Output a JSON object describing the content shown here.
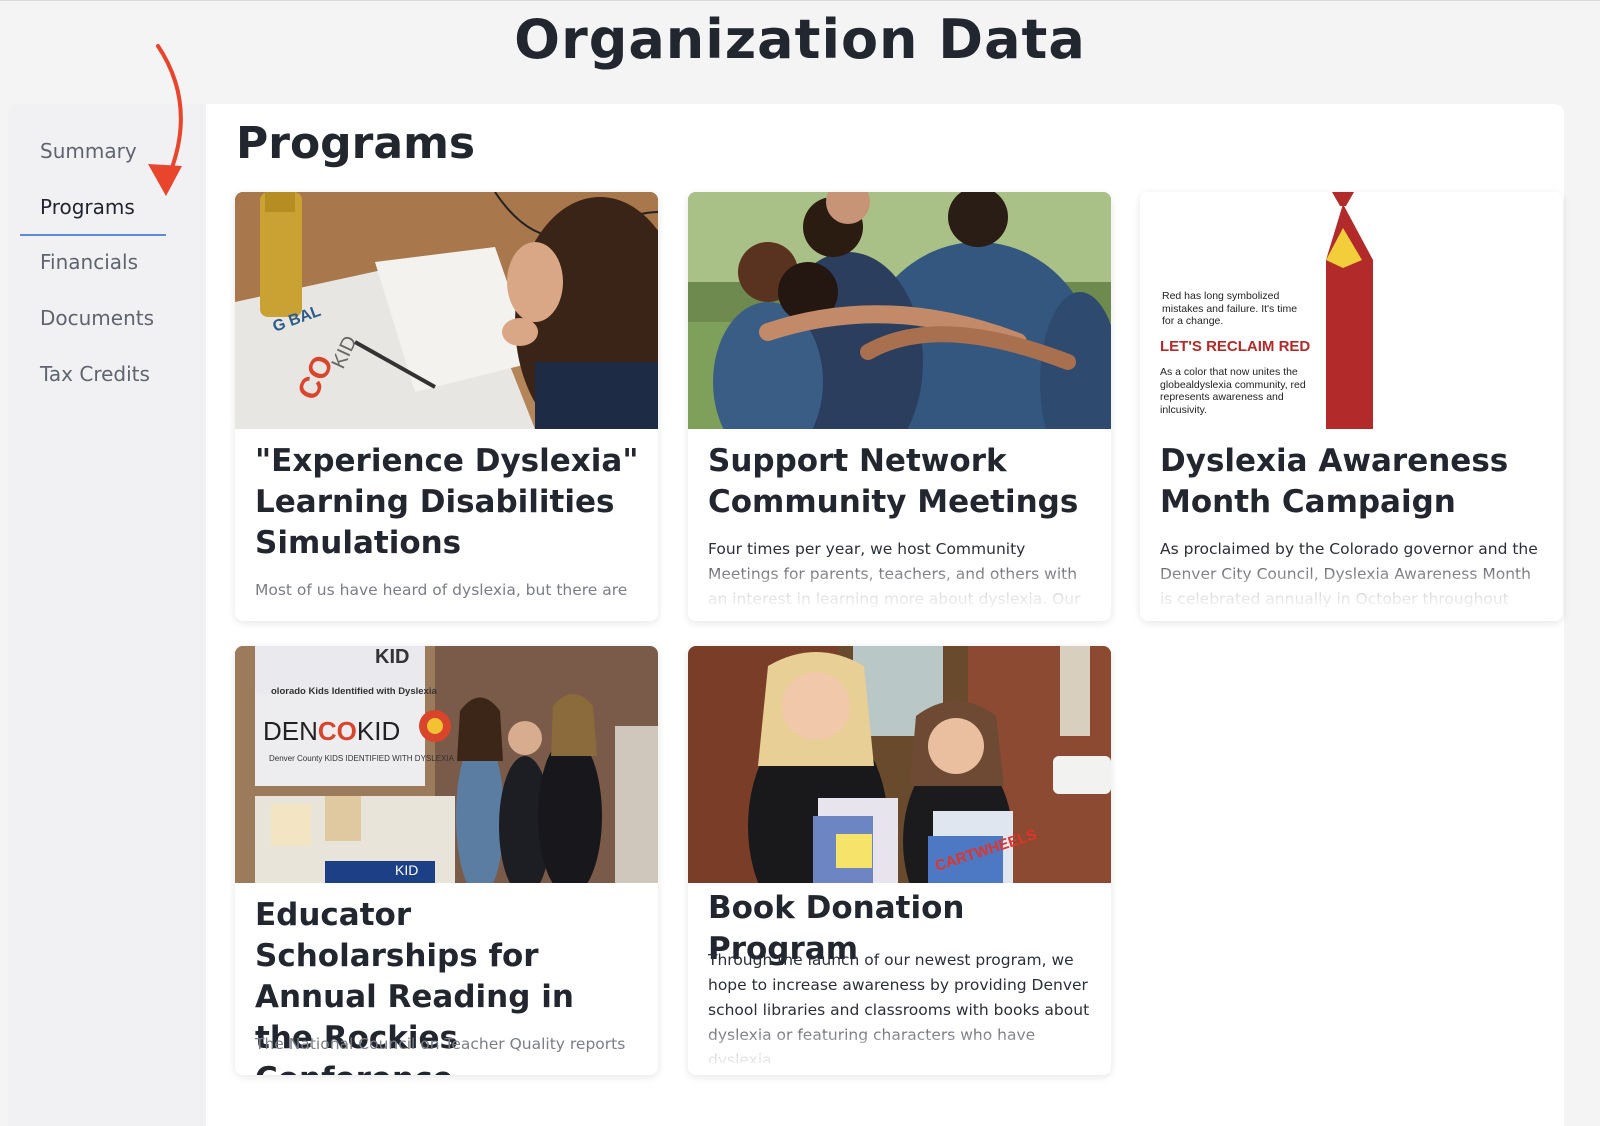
{
  "page": {
    "title": "Organization Data"
  },
  "sidebar": {
    "items": [
      {
        "label": "Summary"
      },
      {
        "label": "Programs"
      },
      {
        "label": "Financials"
      },
      {
        "label": "Documents"
      },
      {
        "label": "Tax Credits"
      }
    ],
    "active": "Programs"
  },
  "main": {
    "section_title": "Programs",
    "cards": [
      {
        "title": "\"Experience Dyslexia\" Learning Disabilities Simulations",
        "description": "Most of us have heard of dyslexia, but there are",
        "image": "photo-simulation-table"
      },
      {
        "title": "Support Network Community Meetings",
        "description": "Four times per year, we host Community Meetings for parents, teachers, and others with an interest in learning more about dyslexia. Our",
        "image": "photo-group-hug"
      },
      {
        "title": "Dyslexia Awareness Month Campaign",
        "description": "As proclaimed by the Colorado governor and the Denver City Council, Dyslexia Awareness Month is celebrated annually in October throughout",
        "image": "graphic-red-pencil",
        "image_text": {
          "line1": "Red has long symbolized mistakes and failure. It's time for a change.",
          "headline": "LET'S RECLAIM RED",
          "line2": "As a color that now unites the globealdyslexia community, red represents awareness and inlcusivity."
        }
      },
      {
        "title": "Educator Scholarships for Annual Reading in the Rockies Conference",
        "description": "The National Council on Teacher Quality reports",
        "image": "photo-booth-women",
        "image_text": {
          "banner_top": "KID",
          "banner_sub": "olorado Kids Identified with Dyslexia",
          "den": "DEN",
          "co": "CO",
          "kid": "KID",
          "county": "Denver County KIDS IDENTIFIED WITH DYSLEXIA",
          "bottom": "KID"
        }
      },
      {
        "title": "Book Donation Program",
        "description": "Through the launch of our newest program, we hope to increase awareness by providing Denver school libraries and classrooms with books about dyslexia or featuring characters who have dyslexia.",
        "image": "photo-girls-books",
        "image_text": {
          "book": "CARTWHEELS"
        }
      }
    ]
  },
  "colors": {
    "accent_underline": "#5b8ddb",
    "arrow": "#e8452c",
    "reclaim_red": "#b22a2a"
  }
}
